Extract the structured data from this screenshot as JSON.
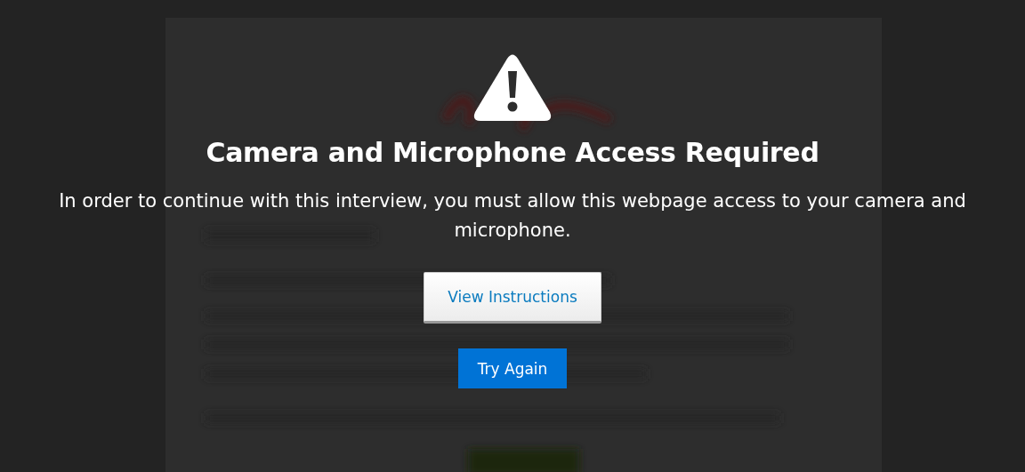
{
  "dialog": {
    "title": "Camera and Microphone Access Required",
    "message": "In order to continue with this interview, you must allow this webpage access to your camera and microphone.",
    "buttons": [
      {
        "label": "View Instructions",
        "kind": "secondary"
      },
      {
        "label": "Try Again",
        "kind": "primary"
      }
    ]
  }
}
